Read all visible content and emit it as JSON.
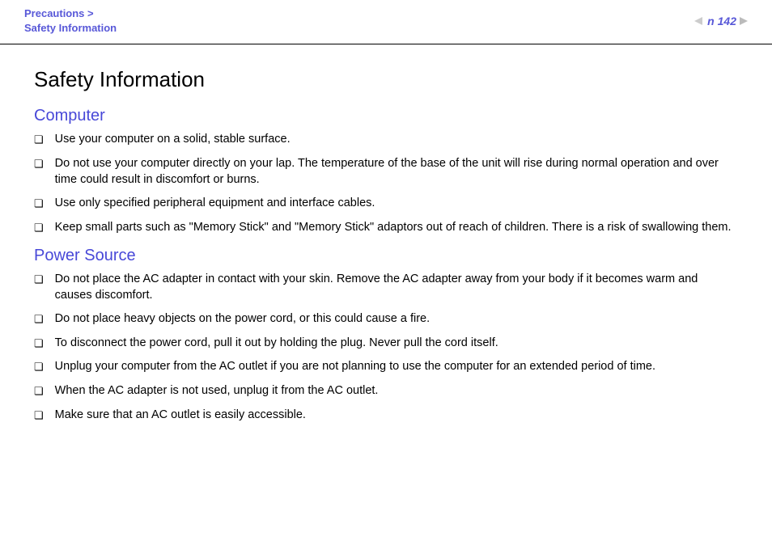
{
  "header": {
    "breadcrumb_line1": "Precautions >",
    "breadcrumb_line2": "Safety Information",
    "page_number": "142",
    "n_mark": "n"
  },
  "content": {
    "title": "Safety Information",
    "sections": [
      {
        "heading": "Computer",
        "items": [
          "Use your computer on a solid, stable surface.",
          "Do not use your computer directly on your lap. The temperature of the base of the unit will rise during normal operation and over time could result in discomfort or burns.",
          "Use only specified peripheral equipment and interface cables.",
          "Keep small parts such as \"Memory Stick\" and \"Memory Stick\" adaptors out of reach of children. There is a risk of swallowing them."
        ]
      },
      {
        "heading": "Power Source",
        "items": [
          "Do not place the AC adapter in contact with your skin. Remove the AC adapter away from your body if it becomes warm and causes discomfort.",
          "Do not place heavy objects on the power cord, or this could cause a fire.",
          "To disconnect the power cord, pull it out by holding the plug. Never pull the cord itself.",
          "Unplug your computer from the AC outlet if you are not planning to use the computer for an extended period of time.",
          "When the AC adapter is not used, unplug it from the AC outlet.",
          "Make sure that an AC outlet is easily accessible."
        ]
      }
    ]
  }
}
